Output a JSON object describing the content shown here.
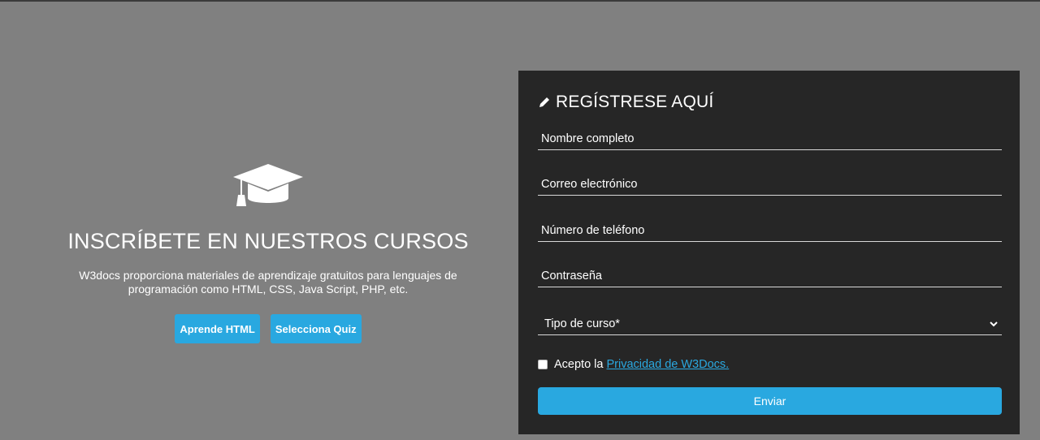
{
  "promo": {
    "icon": "graduation-cap-icon",
    "title": "INSCRÍBETE EN NUESTROS CURSOS",
    "description": "W3docs proporciona materiales de aprendizaje gratuitos para lenguajes de programación como HTML, CSS, Java Script, PHP, etc.",
    "buttons": {
      "learn_html": "Aprende HTML",
      "quiz": "Selecciona Quiz"
    }
  },
  "form": {
    "icon": "pencil-icon",
    "title": "REGÍSTRESE AQUÍ",
    "fields": {
      "full_name": "Nombre completo",
      "email": "Correo electrónico",
      "phone": "Número de teléfono",
      "password": "Contraseña"
    },
    "course_type": {
      "selected": "Tipo de curso*",
      "icon": "chevron-down-icon"
    },
    "privacy": {
      "prefix": "Acepto la",
      "link": "Privacidad de W3Docs."
    },
    "submit_label": "Enviar"
  },
  "colors": {
    "page_background": "#808080",
    "panel_background": "#262626",
    "accent": "#29a8e0"
  }
}
